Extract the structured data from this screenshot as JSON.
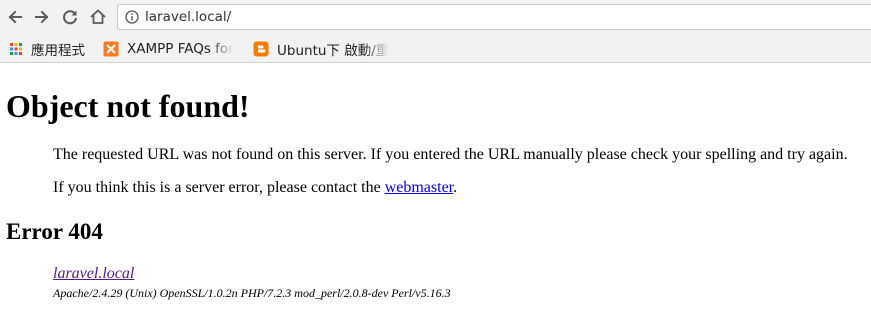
{
  "browser": {
    "address_bar": {
      "url": "laravel.local/"
    },
    "bookmarks": [
      {
        "label": "應用程式",
        "icon": "apps-grid-icon"
      },
      {
        "label": "XAMPP FAQs for",
        "icon": "xampp-icon"
      },
      {
        "label": "Ubuntu下 啟動/重",
        "icon": "blogger-icon"
      }
    ]
  },
  "page": {
    "title": "Object not found!",
    "message": "The requested URL was not found on this server. If you entered the URL manually please check your spelling and try again.",
    "contact_prefix": "If you think this is a server error, please contact the ",
    "contact_link": "webmaster",
    "contact_suffix": ".",
    "error_heading": "Error 404",
    "host_link": "laravel.local",
    "server_signature": "Apache/2.4.29 (Unix) OpenSSL/1.0.2n PHP/7.2.3 mod_perl/2.0.8-dev Perl/v5.16.3"
  },
  "colors": {
    "link": "#0000ee",
    "visited_link": "#551a8b",
    "chrome_background": "#f2f2f2",
    "xampp_orange": "#fb7a24",
    "blogger_orange": "#f57d00"
  }
}
